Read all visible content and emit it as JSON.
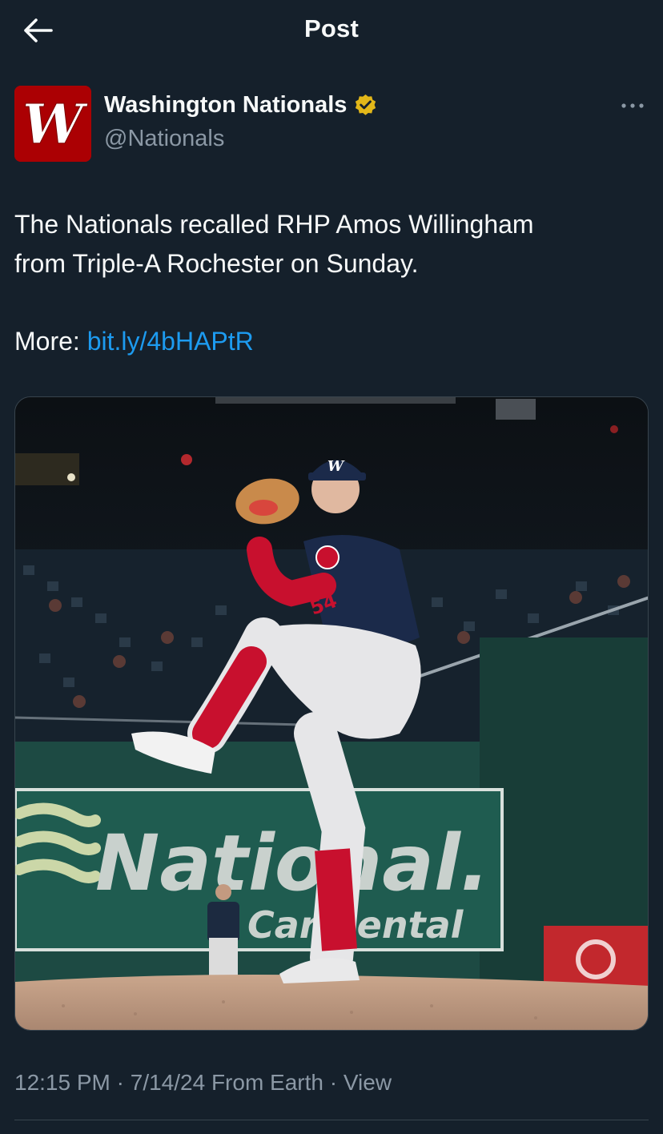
{
  "header": {
    "title": "Post",
    "back_icon": "arrow-left-icon"
  },
  "author": {
    "display_name": "Washington Nationals",
    "handle": "@Nationals",
    "avatar_letter": "W",
    "verified_icon": "verified-badge-icon",
    "more_icon": "more-horizontal-icon"
  },
  "post": {
    "line1": "The Nationals recalled RHP Amos Willingham",
    "line2": "from Triple-A Rochester on Sunday.",
    "more_label": "More:",
    "link": "bit.ly/4bHAPtR"
  },
  "media": {
    "cap_letter": "W",
    "jersey_number": "54",
    "sign_main": "National.",
    "sign_sub": "Car Rental"
  },
  "meta": {
    "time": "12:15 PM",
    "date": "7/14/24",
    "source": "From Earth",
    "view_label": "View",
    "separator": "·"
  },
  "colors": {
    "background": "#15202b",
    "text": "#f7f9f9",
    "secondary": "#8b98a5",
    "link": "#1d9bf0",
    "verified_gold": "#e2b719",
    "brand_red": "#ab0003",
    "sign_green": "#1f5c50"
  }
}
